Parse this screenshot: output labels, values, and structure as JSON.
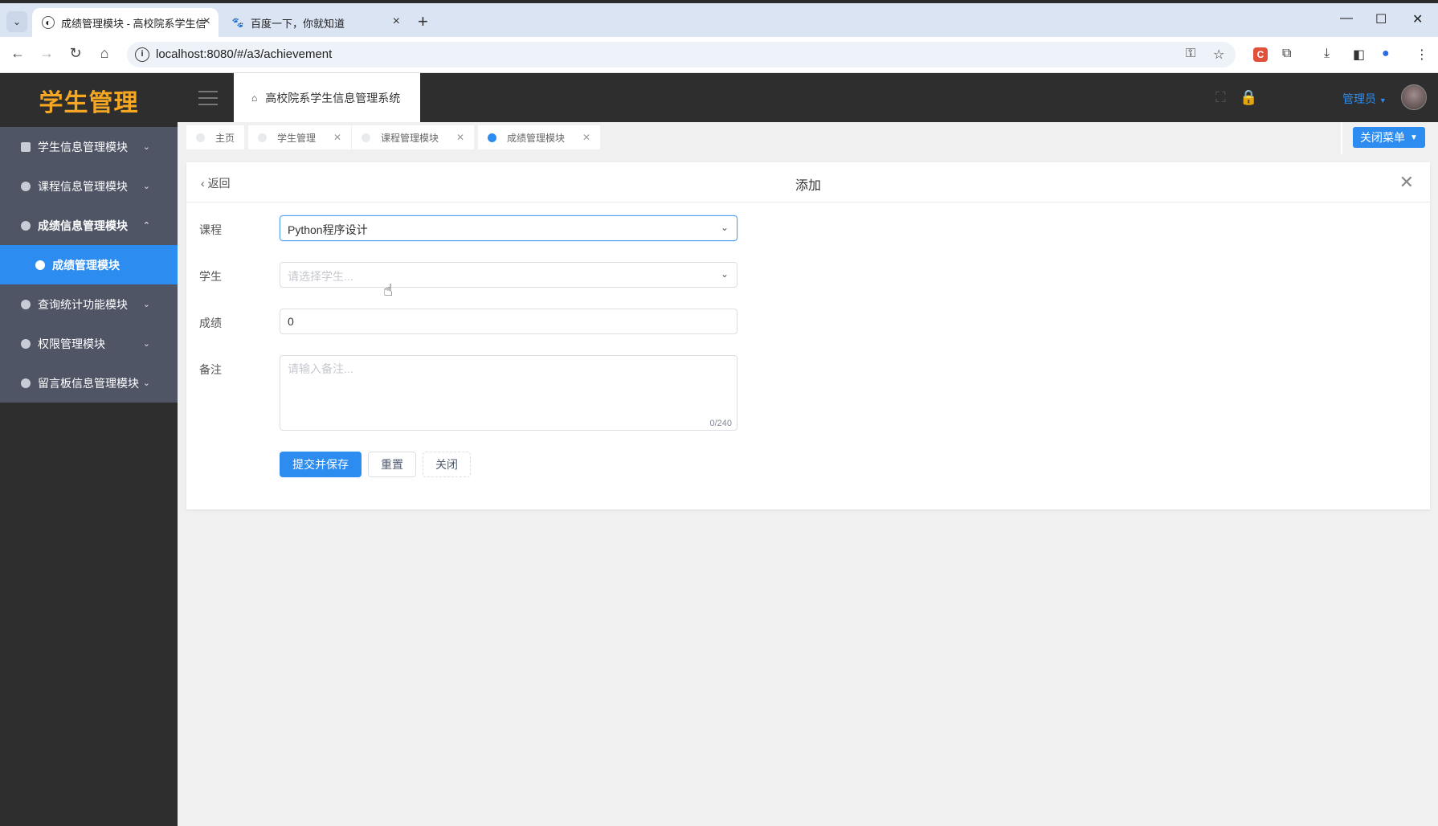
{
  "browser": {
    "tabs": [
      {
        "title": "成绩管理模块 - 高校院系学生信",
        "active": true,
        "icon": "globe-icon"
      },
      {
        "title": "百度一下，你就知道",
        "active": false,
        "icon": "baidu-paw-icon"
      }
    ],
    "url": "localhost:8080/#/a3/achievement"
  },
  "app": {
    "logo": "学生管理",
    "breadcrumb_home": "高校院系学生信息管理系统",
    "user": "管理员",
    "close_menu": "关闭菜单"
  },
  "sidebar": {
    "items": [
      {
        "label": "学生信息管理模块",
        "expanded": false
      },
      {
        "label": "课程信息管理模块",
        "expanded": false
      },
      {
        "label": "成绩信息管理模块",
        "expanded": true
      },
      {
        "label": "成绩管理模块",
        "sub": true,
        "active": true
      },
      {
        "label": "查询统计功能模块",
        "expanded": false
      },
      {
        "label": "权限管理模块",
        "expanded": false
      },
      {
        "label": "留言板信息管理模块",
        "expanded": false
      }
    ]
  },
  "tags": [
    {
      "label": "主页",
      "closable": false,
      "active": false
    },
    {
      "label": "学生管理",
      "closable": true,
      "active": false
    },
    {
      "label": "课程管理模块",
      "closable": true,
      "active": false
    },
    {
      "label": "成绩管理模块",
      "closable": true,
      "active": true
    }
  ],
  "form": {
    "back": "返回",
    "title": "添加",
    "course_label": "课程",
    "course_value": "Python程序设计",
    "student_label": "学生",
    "student_placeholder": "请选择学生...",
    "score_label": "成绩",
    "score_value": "0",
    "remark_label": "备注",
    "remark_placeholder": "请输入备注...",
    "remark_count": "0/240",
    "submit": "提交并保存",
    "reset": "重置",
    "close": "关闭"
  },
  "colors": {
    "primary": "#2d8cf0",
    "logo": "#f5a623",
    "sidebar_bg": "#2e2e2e",
    "menu_bg": "#505566"
  }
}
